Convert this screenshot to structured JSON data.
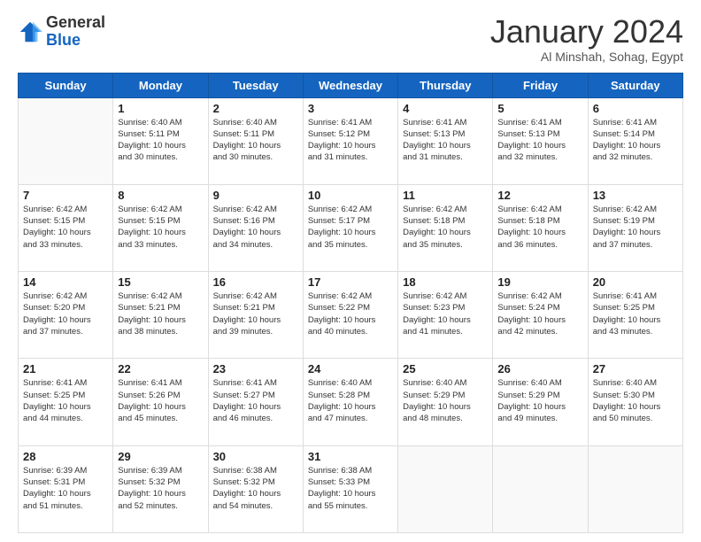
{
  "logo": {
    "general": "General",
    "blue": "Blue"
  },
  "header": {
    "month": "January 2024",
    "location": "Al Minshah, Sohag, Egypt"
  },
  "weekdays": [
    "Sunday",
    "Monday",
    "Tuesday",
    "Wednesday",
    "Thursday",
    "Friday",
    "Saturday"
  ],
  "weeks": [
    [
      {
        "day": "",
        "info": ""
      },
      {
        "day": "1",
        "info": "Sunrise: 6:40 AM\nSunset: 5:11 PM\nDaylight: 10 hours\nand 30 minutes."
      },
      {
        "day": "2",
        "info": "Sunrise: 6:40 AM\nSunset: 5:11 PM\nDaylight: 10 hours\nand 30 minutes."
      },
      {
        "day": "3",
        "info": "Sunrise: 6:41 AM\nSunset: 5:12 PM\nDaylight: 10 hours\nand 31 minutes."
      },
      {
        "day": "4",
        "info": "Sunrise: 6:41 AM\nSunset: 5:13 PM\nDaylight: 10 hours\nand 31 minutes."
      },
      {
        "day": "5",
        "info": "Sunrise: 6:41 AM\nSunset: 5:13 PM\nDaylight: 10 hours\nand 32 minutes."
      },
      {
        "day": "6",
        "info": "Sunrise: 6:41 AM\nSunset: 5:14 PM\nDaylight: 10 hours\nand 32 minutes."
      }
    ],
    [
      {
        "day": "7",
        "info": "Sunrise: 6:42 AM\nSunset: 5:15 PM\nDaylight: 10 hours\nand 33 minutes."
      },
      {
        "day": "8",
        "info": "Sunrise: 6:42 AM\nSunset: 5:15 PM\nDaylight: 10 hours\nand 33 minutes."
      },
      {
        "day": "9",
        "info": "Sunrise: 6:42 AM\nSunset: 5:16 PM\nDaylight: 10 hours\nand 34 minutes."
      },
      {
        "day": "10",
        "info": "Sunrise: 6:42 AM\nSunset: 5:17 PM\nDaylight: 10 hours\nand 35 minutes."
      },
      {
        "day": "11",
        "info": "Sunrise: 6:42 AM\nSunset: 5:18 PM\nDaylight: 10 hours\nand 35 minutes."
      },
      {
        "day": "12",
        "info": "Sunrise: 6:42 AM\nSunset: 5:18 PM\nDaylight: 10 hours\nand 36 minutes."
      },
      {
        "day": "13",
        "info": "Sunrise: 6:42 AM\nSunset: 5:19 PM\nDaylight: 10 hours\nand 37 minutes."
      }
    ],
    [
      {
        "day": "14",
        "info": "Sunrise: 6:42 AM\nSunset: 5:20 PM\nDaylight: 10 hours\nand 37 minutes."
      },
      {
        "day": "15",
        "info": "Sunrise: 6:42 AM\nSunset: 5:21 PM\nDaylight: 10 hours\nand 38 minutes."
      },
      {
        "day": "16",
        "info": "Sunrise: 6:42 AM\nSunset: 5:21 PM\nDaylight: 10 hours\nand 39 minutes."
      },
      {
        "day": "17",
        "info": "Sunrise: 6:42 AM\nSunset: 5:22 PM\nDaylight: 10 hours\nand 40 minutes."
      },
      {
        "day": "18",
        "info": "Sunrise: 6:42 AM\nSunset: 5:23 PM\nDaylight: 10 hours\nand 41 minutes."
      },
      {
        "day": "19",
        "info": "Sunrise: 6:42 AM\nSunset: 5:24 PM\nDaylight: 10 hours\nand 42 minutes."
      },
      {
        "day": "20",
        "info": "Sunrise: 6:41 AM\nSunset: 5:25 PM\nDaylight: 10 hours\nand 43 minutes."
      }
    ],
    [
      {
        "day": "21",
        "info": "Sunrise: 6:41 AM\nSunset: 5:25 PM\nDaylight: 10 hours\nand 44 minutes."
      },
      {
        "day": "22",
        "info": "Sunrise: 6:41 AM\nSunset: 5:26 PM\nDaylight: 10 hours\nand 45 minutes."
      },
      {
        "day": "23",
        "info": "Sunrise: 6:41 AM\nSunset: 5:27 PM\nDaylight: 10 hours\nand 46 minutes."
      },
      {
        "day": "24",
        "info": "Sunrise: 6:40 AM\nSunset: 5:28 PM\nDaylight: 10 hours\nand 47 minutes."
      },
      {
        "day": "25",
        "info": "Sunrise: 6:40 AM\nSunset: 5:29 PM\nDaylight: 10 hours\nand 48 minutes."
      },
      {
        "day": "26",
        "info": "Sunrise: 6:40 AM\nSunset: 5:29 PM\nDaylight: 10 hours\nand 49 minutes."
      },
      {
        "day": "27",
        "info": "Sunrise: 6:40 AM\nSunset: 5:30 PM\nDaylight: 10 hours\nand 50 minutes."
      }
    ],
    [
      {
        "day": "28",
        "info": "Sunrise: 6:39 AM\nSunset: 5:31 PM\nDaylight: 10 hours\nand 51 minutes."
      },
      {
        "day": "29",
        "info": "Sunrise: 6:39 AM\nSunset: 5:32 PM\nDaylight: 10 hours\nand 52 minutes."
      },
      {
        "day": "30",
        "info": "Sunrise: 6:38 AM\nSunset: 5:32 PM\nDaylight: 10 hours\nand 54 minutes."
      },
      {
        "day": "31",
        "info": "Sunrise: 6:38 AM\nSunset: 5:33 PM\nDaylight: 10 hours\nand 55 minutes."
      },
      {
        "day": "",
        "info": ""
      },
      {
        "day": "",
        "info": ""
      },
      {
        "day": "",
        "info": ""
      }
    ]
  ]
}
